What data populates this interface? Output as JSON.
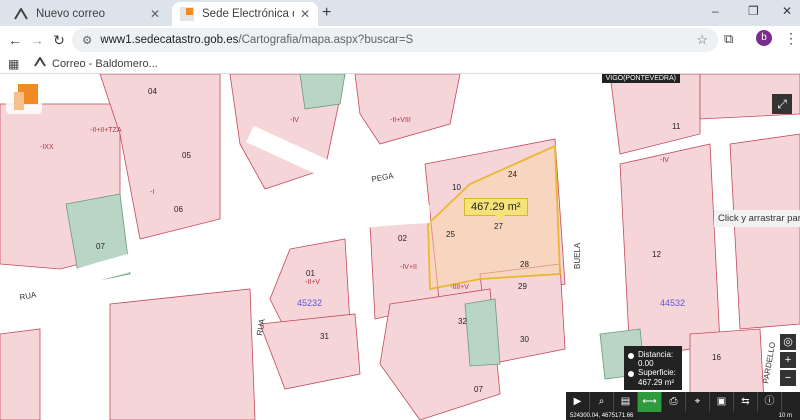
{
  "browser": {
    "tabs": [
      {
        "label": "Nuevo correo",
        "icon": "mail-icon"
      },
      {
        "label": "Sede Electrónica del Catastro -",
        "icon": "catastro-icon"
      }
    ],
    "new_tab": "+",
    "window": {
      "minimize": "–",
      "restore": "❐",
      "close": "✕"
    },
    "url_host": "www1.sedecatastro.gob.es",
    "url_path": "/Cartografia/mapa.aspx?buscar=S",
    "avatar_letter": "b",
    "bookmarks": [
      {
        "label": "Correo - Baldomero..."
      }
    ]
  },
  "map": {
    "municipality": "VIGO(PONTEVEDRA)",
    "streets": [
      "PEGA",
      "RUA",
      "RUA",
      "BUELA",
      "RUA",
      "PARDELLO"
    ],
    "parcel_numbers": [
      "04",
      "05",
      "06",
      "07",
      "01",
      "02",
      "03",
      "31",
      "32",
      "07",
      "10",
      "24",
      "25",
      "27",
      "28",
      "29",
      "30",
      "11",
      "12",
      "16",
      "07",
      "06",
      "02",
      "01",
      "2",
      "1",
      "9"
    ],
    "blocks": [
      "45232",
      "44532",
      "46532"
    ],
    "selection_area": "467.29 m²",
    "drag_hint": "Click y arrastrar para",
    "measure": {
      "distance_label": "Distancia:",
      "distance_value": "0.00",
      "surface_label": "Superficie:",
      "surface_value": "467.29 m²"
    },
    "coords": "524300.04, 4675171.66",
    "scale": "10 m",
    "zoom_in": "+",
    "zoom_out": "−"
  },
  "colors": {
    "parcel_fill": "#f6d5d8",
    "parcel_edge": "#c24a5a",
    "green": "#b9d5c4",
    "selection": "#e9b730"
  }
}
